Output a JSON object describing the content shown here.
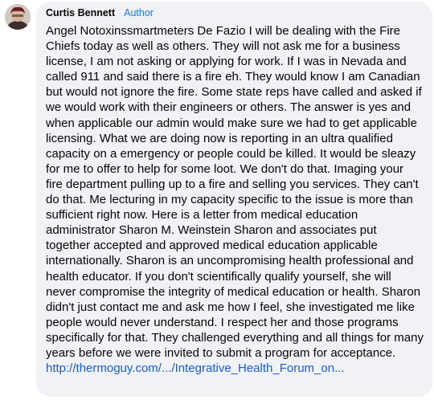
{
  "comment": {
    "author": "Curtis Bennett",
    "badge": "Author",
    "text": "Angel Notoxinssmartmeters De Fazio I will be dealing with the Fire Chiefs today as well as others. They will not ask me for a business license, I am not asking or applying for work. If I was in Nevada and called 911 and said there is a fire eh. They would know I am Canadian but would not ignore the fire. Some state reps have called and asked if we would work with their engineers or others. The answer is yes and when applicable our admin would make sure we had to get applicable licensing. What we are doing now is reporting in an ultra qualified capacity on a emergency or people could be killed. It would be sleazy for me to offer to help for some loot. We don't do that. Imaging your fire department pulling up to a fire and selling you services. They can't do that. Me lecturing in my capacity specific to the issue is more than sufficient right now. Here is a letter from medical education administrator Sharon M. Weinstein Sharon and associates put together accepted and approved medical education applicable internationally. Sharon is an uncompromising health professional and health educator. If you don't scientifically qualify yourself, she will never compromise the integrity of medical education or health. Sharon didn't just contact me and ask me how I feel, she investigated me like people would never understand. I respect her and those programs specifically for that. They challenged everything and all things for many years before we were invited to submit a program for acceptance.",
    "link": "http://thermoguy.com/.../Integrative_Health_Forum_on..."
  },
  "colors": {
    "bubble": "#f0f2f5",
    "author_badge": "#1877f2",
    "link": "#1a5bd6"
  }
}
